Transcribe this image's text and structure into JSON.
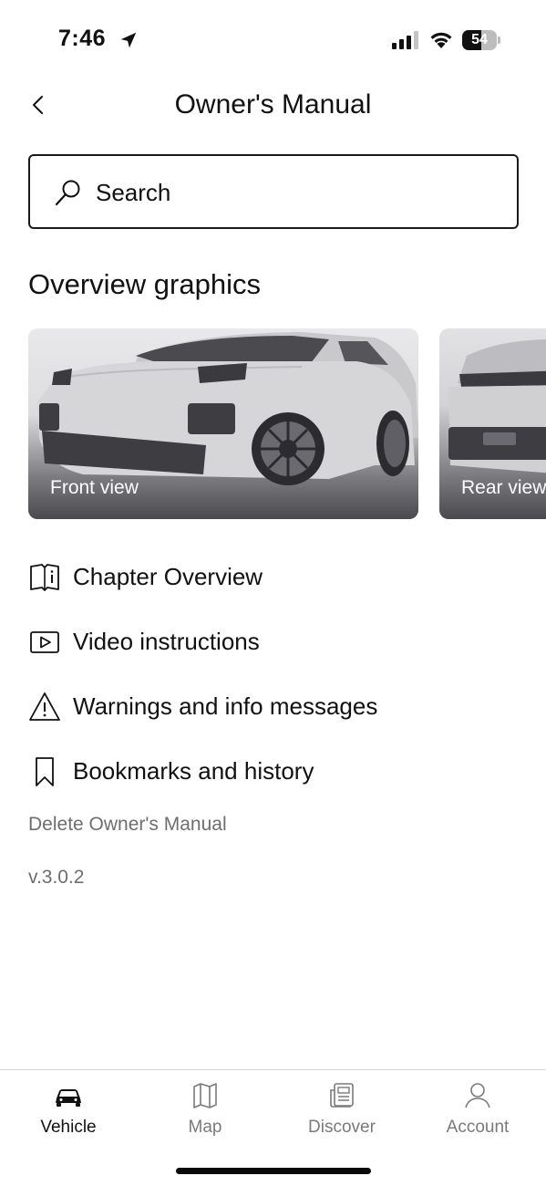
{
  "status_bar": {
    "time": "7:46",
    "battery_level": "54",
    "icons": [
      "location-arrow-icon",
      "signal-icon",
      "wifi-icon",
      "battery-icon"
    ]
  },
  "header": {
    "title": "Owner's Manual",
    "back_icon": "chevron-left-icon"
  },
  "search": {
    "label": "Search",
    "icon": "search-icon"
  },
  "overview": {
    "title": "Overview graphics",
    "cards": [
      {
        "label": "Front view"
      },
      {
        "label": "Rear view"
      }
    ]
  },
  "menu": {
    "items": [
      {
        "label": "Chapter Overview",
        "icon": "book-info-icon"
      },
      {
        "label": "Video instructions",
        "icon": "play-icon"
      },
      {
        "label": "Warnings and info messages",
        "icon": "warning-icon"
      },
      {
        "label": "Bookmarks and history",
        "icon": "bookmark-icon"
      }
    ]
  },
  "footer_links": {
    "delete": "Delete Owner's Manual",
    "version": "v.3.0.2"
  },
  "tab_bar": {
    "active": "Vehicle",
    "tabs": [
      {
        "label": "Vehicle",
        "icon": "car-icon"
      },
      {
        "label": "Map",
        "icon": "map-icon"
      },
      {
        "label": "Discover",
        "icon": "newspaper-icon"
      },
      {
        "label": "Account",
        "icon": "user-icon"
      }
    ]
  },
  "colors": {
    "text": "#111111",
    "muted": "#6e6e6e",
    "inactive_tab": "#7a7a7a",
    "divider": "#d8d8d8"
  }
}
